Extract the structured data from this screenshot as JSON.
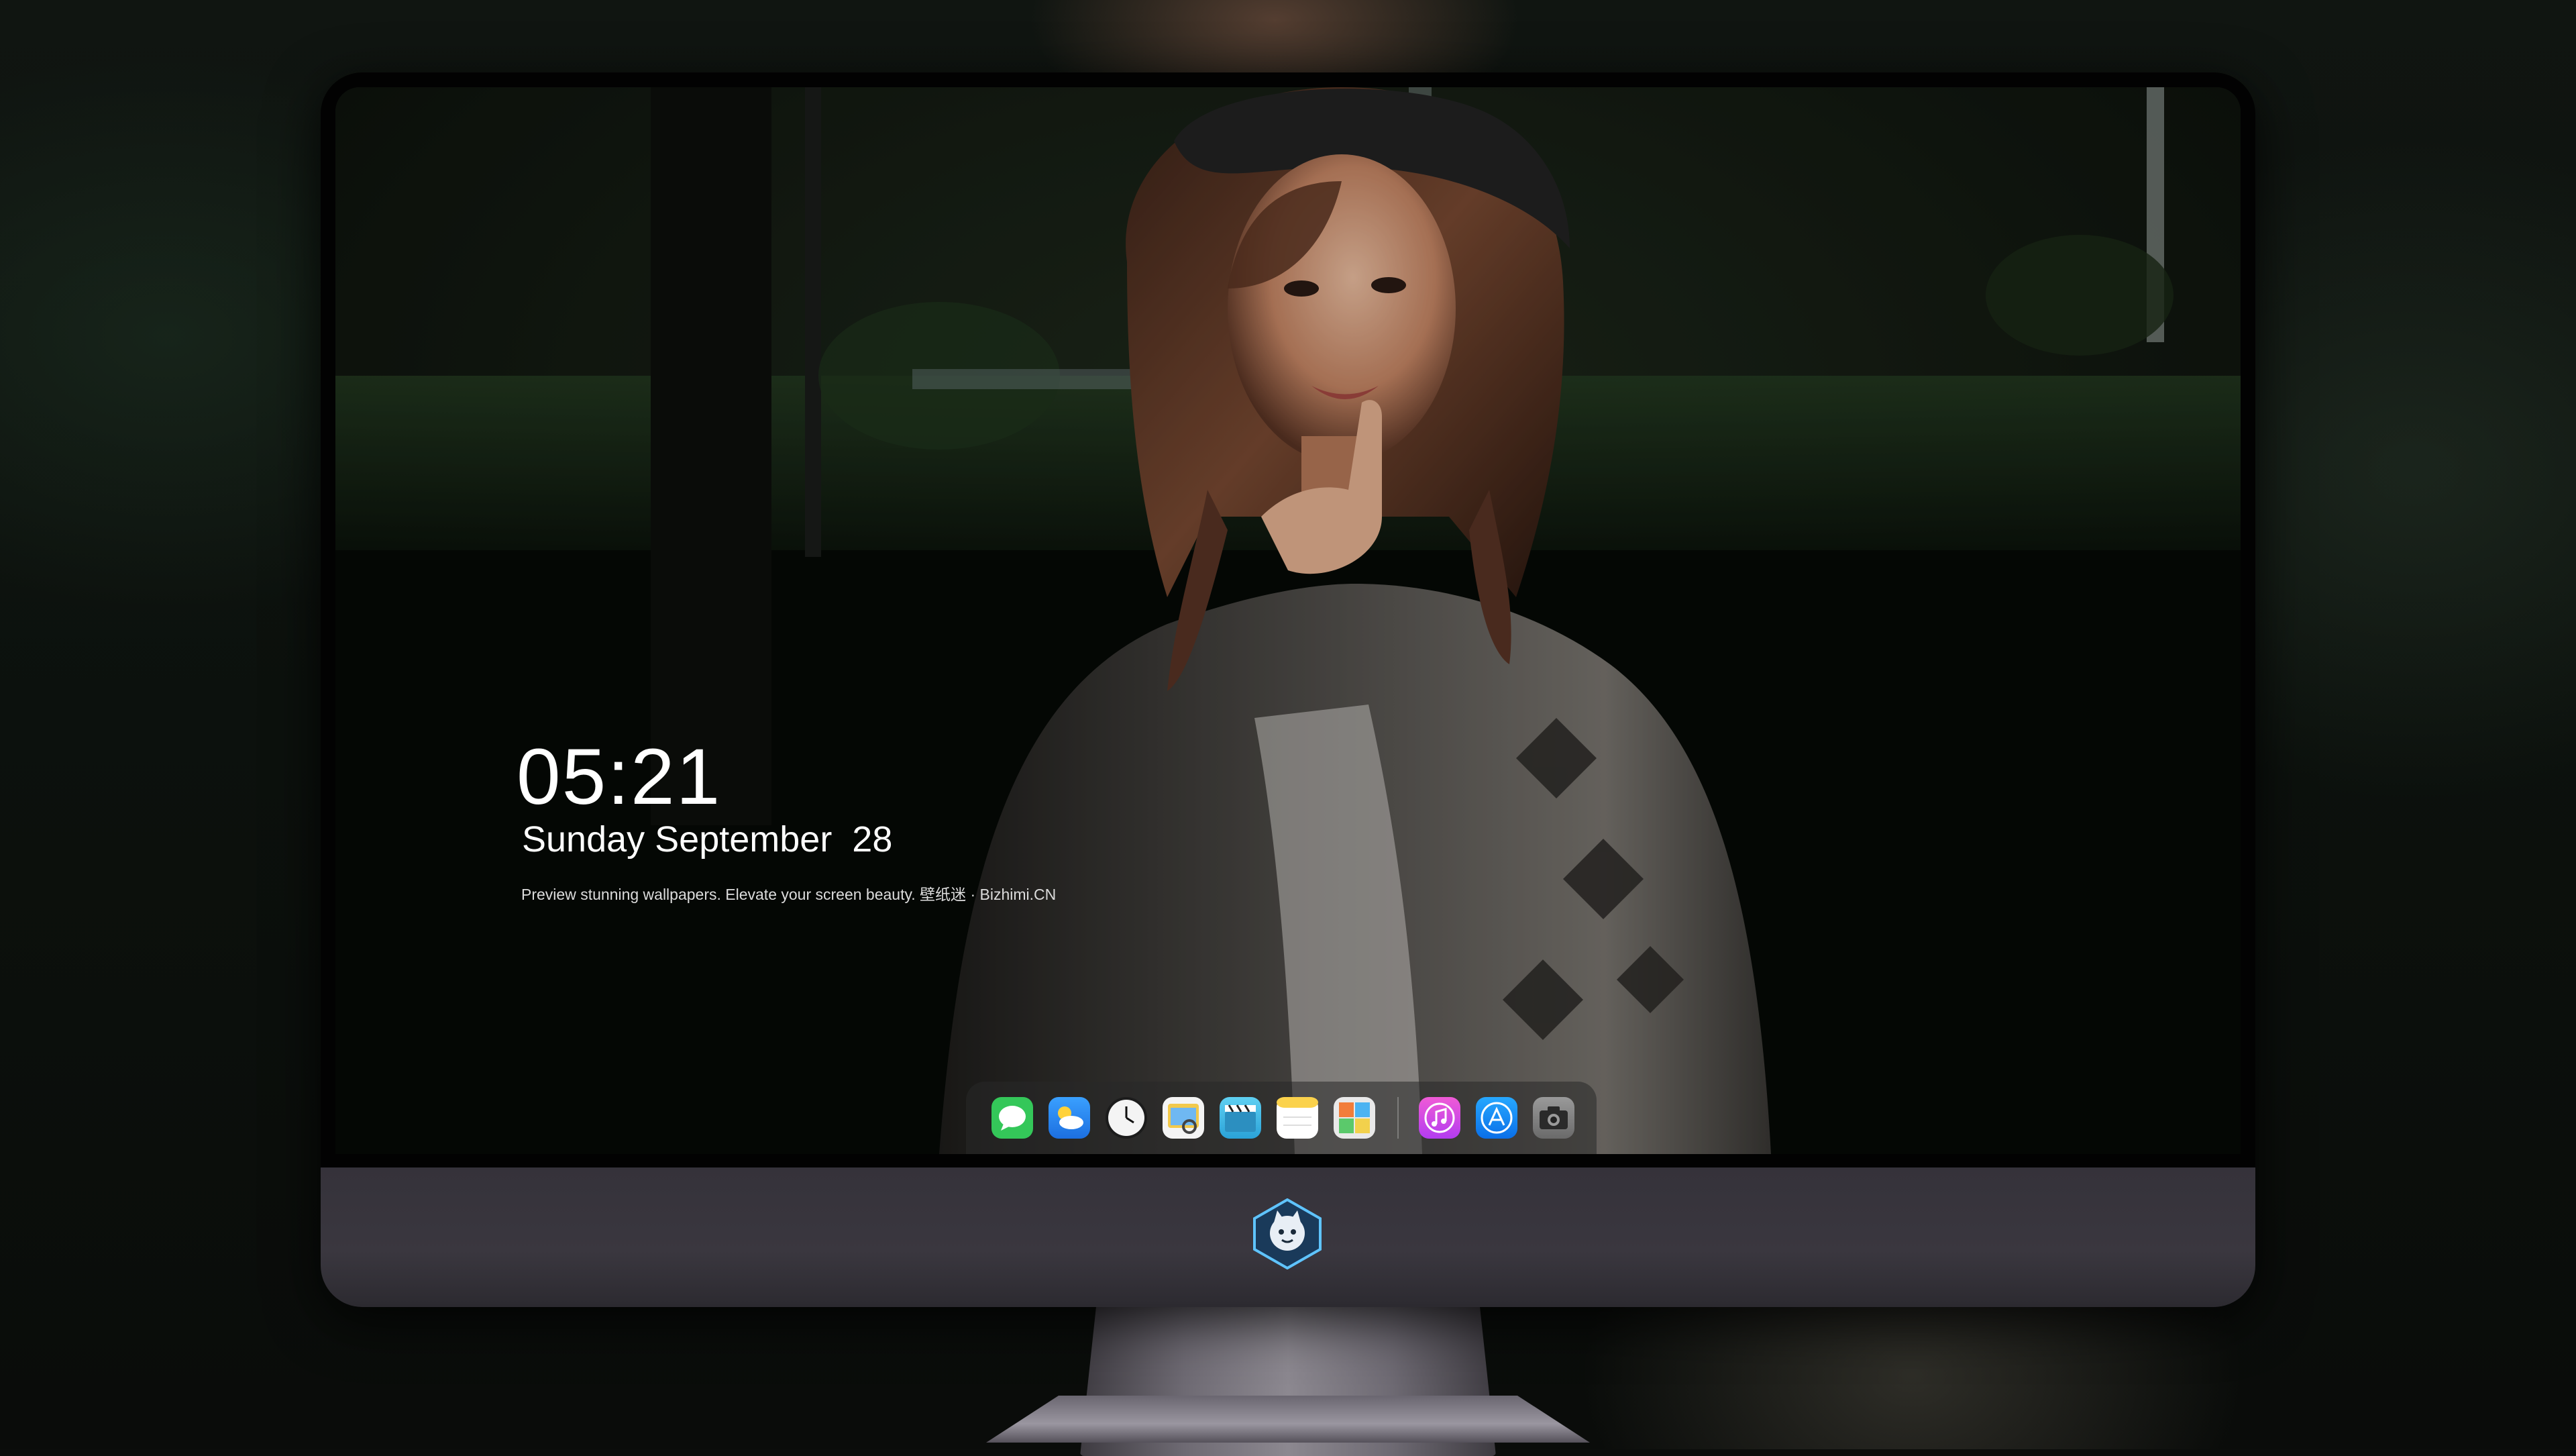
{
  "lockscreen": {
    "time": "05:21",
    "date": "Sunday September  28",
    "tagline": "Preview stunning wallpapers. Elevate your screen beauty. 壁纸迷 · Bizhimi.CN"
  },
  "dock": {
    "apps": [
      {
        "name": "messages-icon",
        "color": "#2fd158"
      },
      {
        "name": "weather-icon",
        "color": "#2f8ef7"
      },
      {
        "name": "clock-icon",
        "color": "#f2f2f2"
      },
      {
        "name": "preview-icon",
        "color": "#f2c94c"
      },
      {
        "name": "video-clapper-icon",
        "color": "#4fc3e8"
      },
      {
        "name": "notes-icon",
        "color": "#fbd24c"
      },
      {
        "name": "photo-gallery-icon",
        "color": "#e9e9e9"
      },
      {
        "name": "itunes-icon",
        "color": "#e04fd8"
      },
      {
        "name": "app-store-icon",
        "color": "#1a8cff"
      },
      {
        "name": "camera-icon",
        "color": "#8a8a8a"
      }
    ]
  },
  "monitor": {
    "chin_logo": "ninja-cat-logo-icon"
  }
}
